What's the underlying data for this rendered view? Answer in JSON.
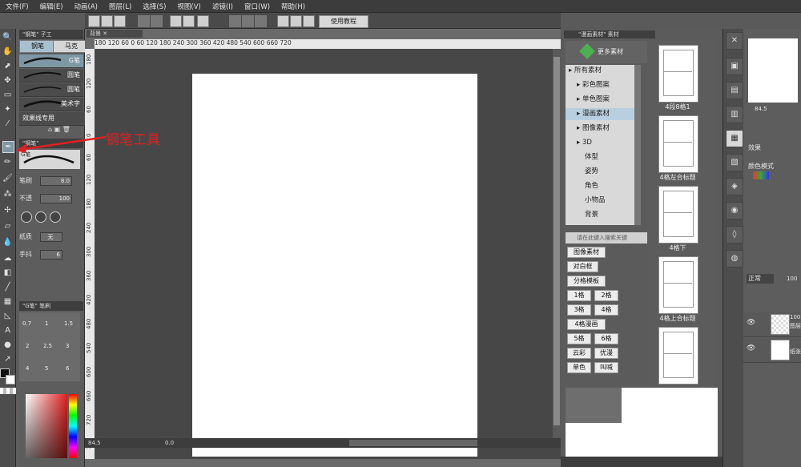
{
  "menu": [
    "文件(F)",
    "编辑(E)",
    "动画(A)",
    "图层(L)",
    "选择(S)",
    "视图(V)",
    "滤镜(I)",
    "窗口(W)",
    "帮助(H)"
  ],
  "toolbar": {
    "hint_button": "使用教程"
  },
  "tool_panel": {
    "tab_label": "\"钢笔\" 子工",
    "subtabs": [
      "钢笔",
      "马克"
    ],
    "brushes": [
      "G笔",
      "圆笔",
      "圆笔",
      "美术字",
      "效果线专用"
    ],
    "pen_tab_label": "\"钢笔\"",
    "pen_preview_label": "G笔",
    "size_label": "笔刷",
    "size_value": "8.0",
    "opacity_label": "不透",
    "opacity_value": "100",
    "texture_label": "纸质",
    "texture_value": "无",
    "smooth_label": "手抖",
    "smooth_value": "6"
  },
  "annotation": "钢笔工具",
  "canvas": {
    "doc_tab": "背景",
    "ruler_top": "180  120   60    0    60   120   180   240   300   360   420   480   540   600   660   720",
    "ruler_left": [
      "180",
      "120",
      "60",
      "0",
      "60",
      "120",
      "180",
      "240",
      "300",
      "360",
      "420",
      "480",
      "540",
      "600",
      "660",
      "720",
      "780"
    ],
    "zoom": "84.5",
    "angle": "0.0"
  },
  "material_panel": {
    "tab_label": "\"漫画素材\" 素材",
    "more_button": "更多素材",
    "tree": [
      {
        "label": "所有素材",
        "indent": 0,
        "sel": false
      },
      {
        "label": "彩色图案",
        "indent": 1,
        "sel": false
      },
      {
        "label": "单色图案",
        "indent": 1,
        "sel": false
      },
      {
        "label": "漫画素材",
        "indent": 1,
        "sel": true
      },
      {
        "label": "图像素材",
        "indent": 1,
        "sel": false
      },
      {
        "label": "3D",
        "indent": 1,
        "sel": false
      },
      {
        "label": "体型",
        "indent": 2,
        "sel": false
      },
      {
        "label": "姿势",
        "indent": 2,
        "sel": false
      },
      {
        "label": "角色",
        "indent": 2,
        "sel": false
      },
      {
        "label": "小物品",
        "indent": 2,
        "sel": false
      },
      {
        "label": "背景",
        "indent": 2,
        "sel": false
      }
    ],
    "search_placeholder": "请在此键入搜索关键",
    "tags": [
      [
        "图像素材"
      ],
      [
        "对白框"
      ],
      [
        "分格模板"
      ],
      [
        "1格",
        "2格"
      ],
      [
        "3格",
        "4格"
      ],
      [
        "4格漫画"
      ],
      [
        "5格",
        "6格"
      ],
      [
        "云彩",
        "优漫"
      ],
      [
        "单色",
        "叫喊"
      ]
    ],
    "thumbs": [
      "4段8格1",
      "4格左合标题",
      "4格下",
      "4格上合标题",
      ""
    ]
  },
  "layer_panel": {
    "zoom": "84.5",
    "effect_label": "效果",
    "color_mode_label": "颜色模式",
    "blend_mode": "正常",
    "opacity": "100",
    "layers": [
      {
        "opacity": "100",
        "name": "图层"
      },
      {
        "opacity": "",
        "name": "纸张"
      }
    ]
  },
  "colors": {
    "accent_red": "#e02020",
    "selection_blue": "#7e97a5",
    "paper": "#ffffff"
  }
}
